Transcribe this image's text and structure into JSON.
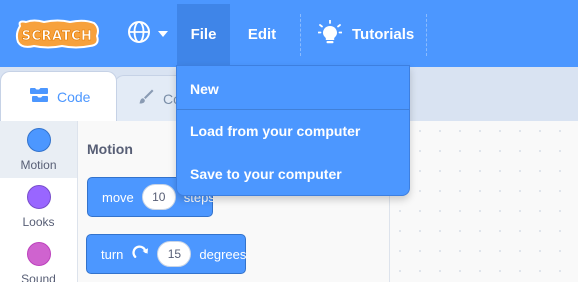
{
  "menubar": {
    "logo_text": "SCRATCH",
    "file_label": "File",
    "edit_label": "Edit",
    "tutorials_label": "Tutorials"
  },
  "tabs": {
    "code_label": "Code",
    "costumes_label": "Costumes"
  },
  "file_menu": {
    "items": [
      "New",
      "Load from your computer",
      "Save to your computer"
    ]
  },
  "categories": [
    {
      "label": "Motion",
      "color": "#4c97ff"
    },
    {
      "label": "Looks",
      "color": "#9966ff"
    },
    {
      "label": "Sound",
      "color": "#cf63cf"
    }
  ],
  "palette": {
    "title": "Motion",
    "blocks": [
      {
        "prefix": "move",
        "value": "10",
        "suffix": "steps"
      },
      {
        "prefix": "turn",
        "value": "15",
        "suffix": "degrees"
      }
    ]
  },
  "colors": {
    "menubar": "#4c97ff",
    "file_active": "#3f85e8",
    "logo_orange": "#f7a13c"
  },
  "icons": {
    "language": "globe-icon",
    "tutorials": "lightbulb-icon",
    "code_tab": "code-blocks-icon",
    "costumes_tab": "paintbrush-icon",
    "turn_block": "rotate-clockwise-icon"
  }
}
